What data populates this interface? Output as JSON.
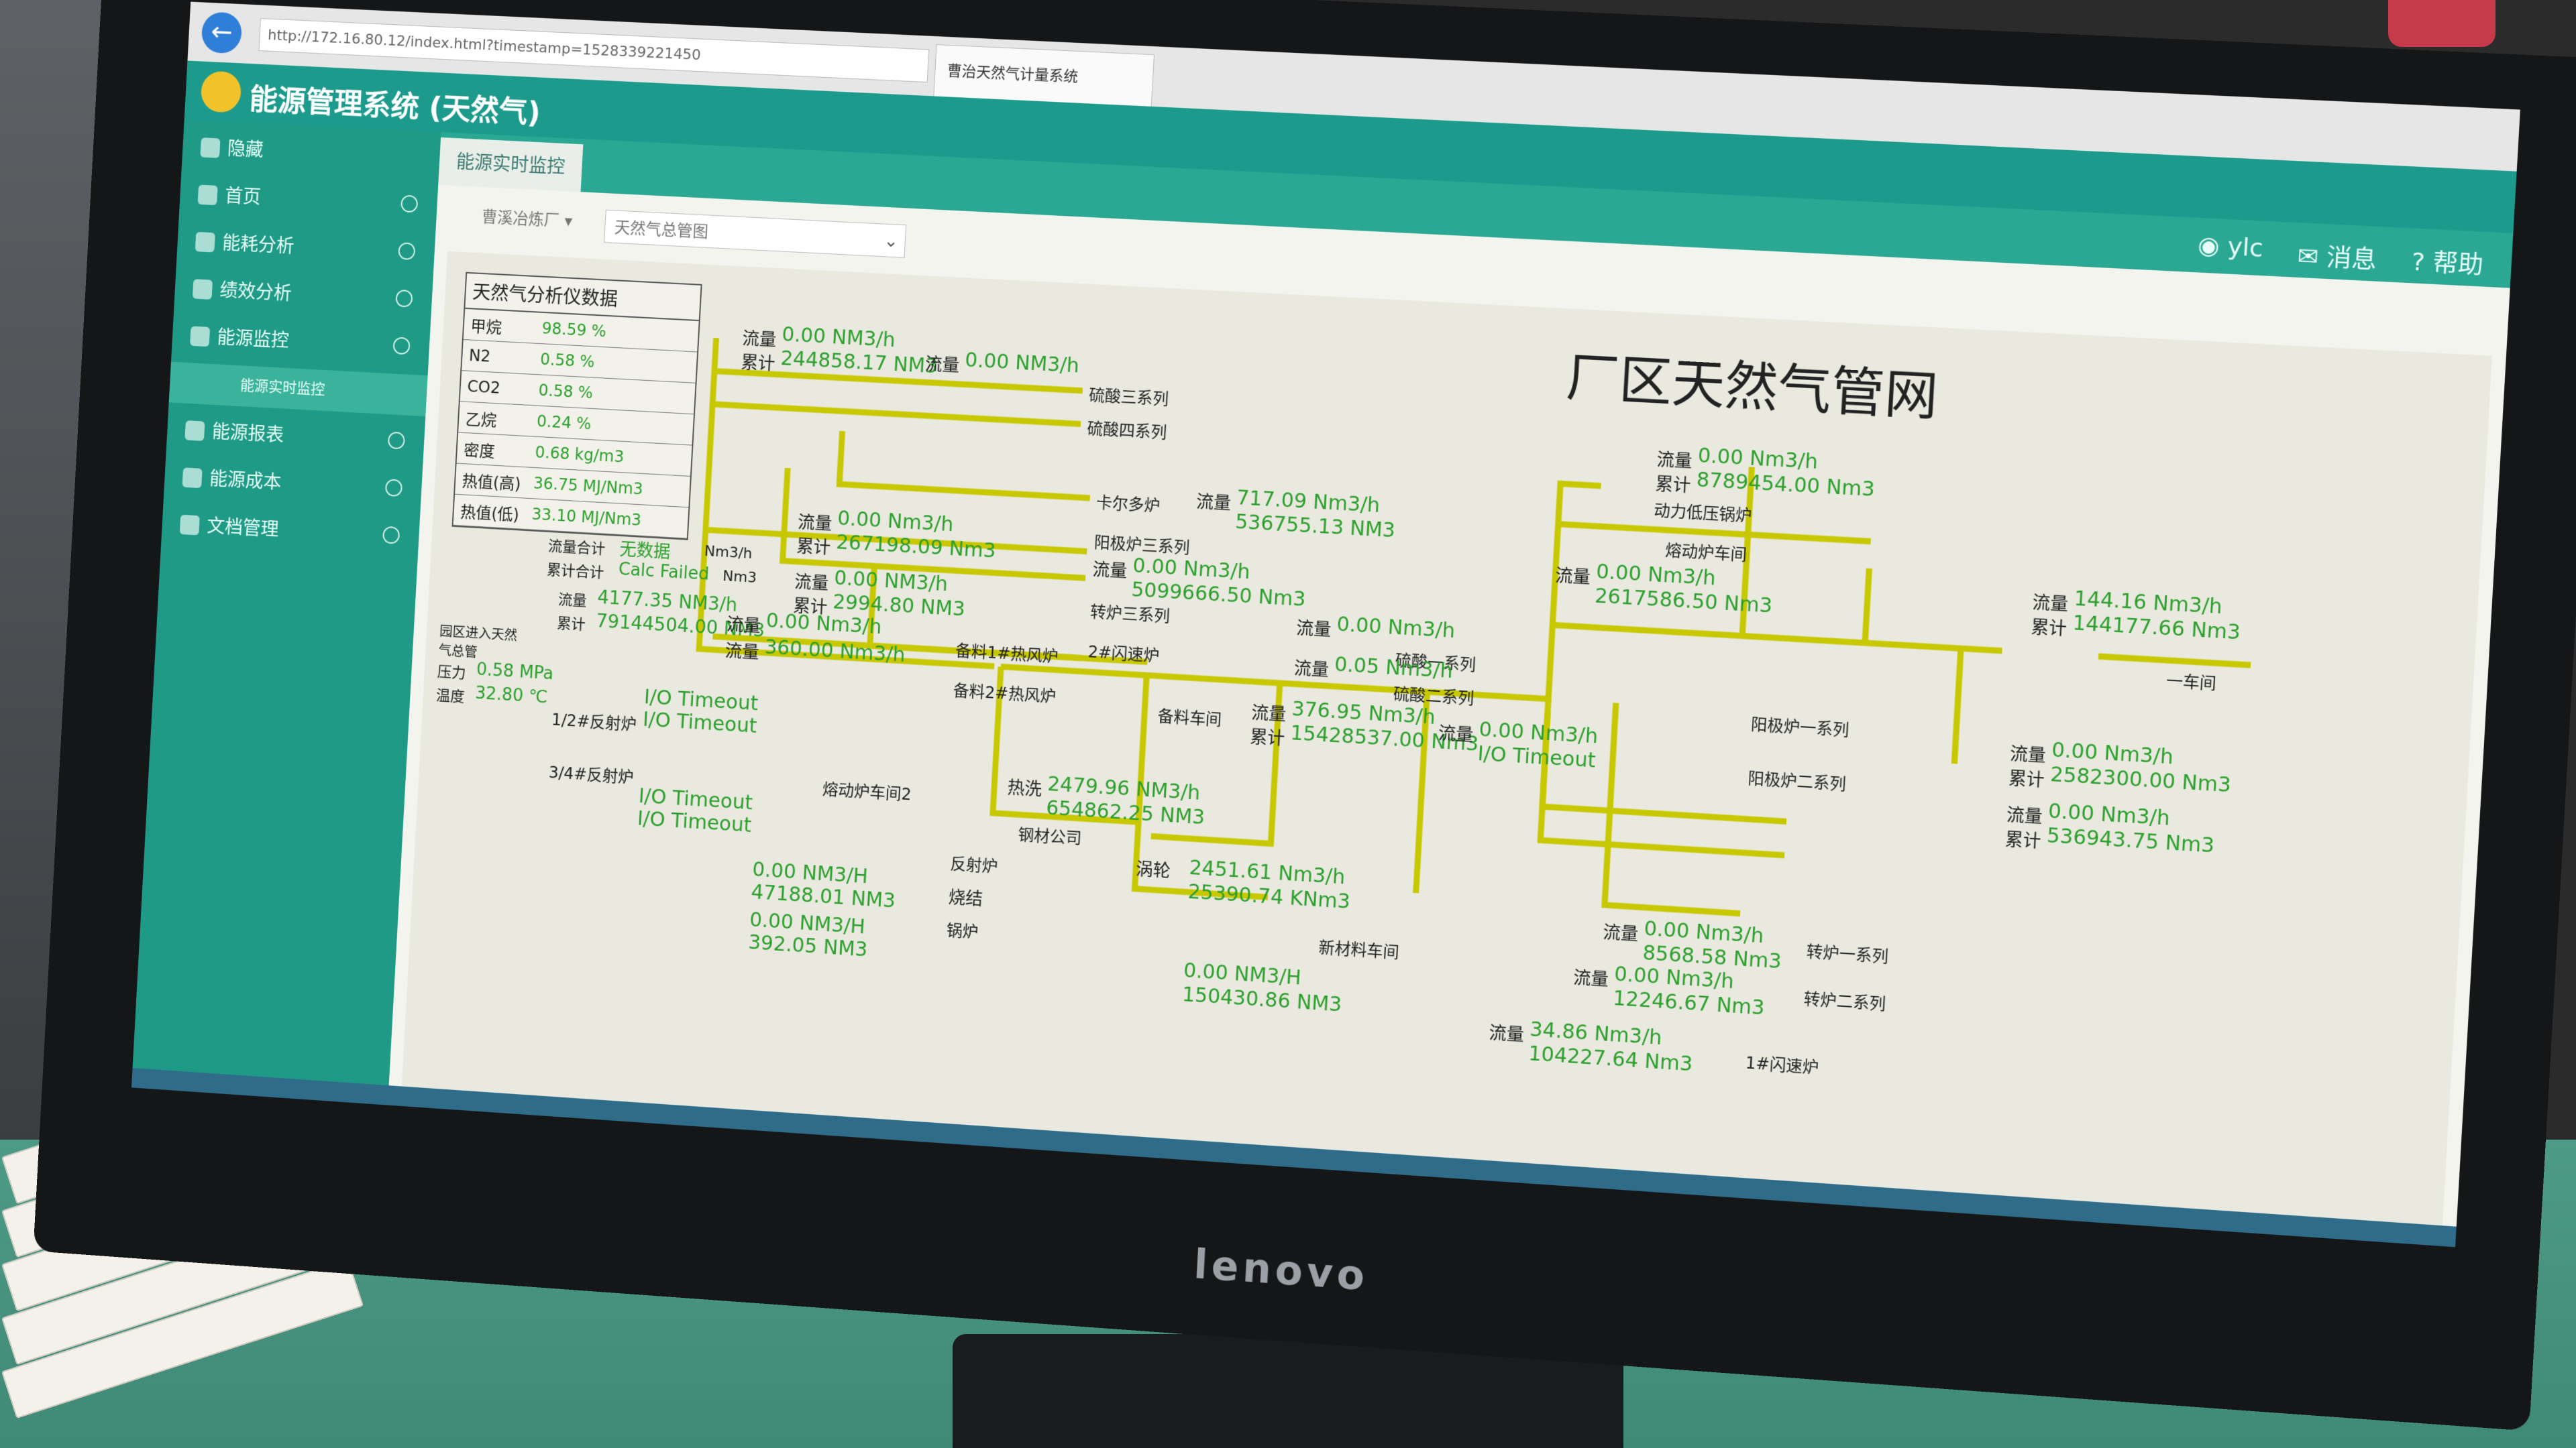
{
  "browser": {
    "url": "http://172.16.80.12/index.html?timestamp=1528339221450",
    "tab_title": "曹治天然气计量系统"
  },
  "app": {
    "title": "能源管理系统 (天然气)",
    "active_tab": "能源实时监控",
    "user": "ylc",
    "messages": "消息",
    "help": "帮助"
  },
  "sidebar": {
    "items": [
      {
        "label": "隐藏"
      },
      {
        "label": "首页"
      },
      {
        "label": "能耗分析"
      },
      {
        "label": "绩效分析"
      },
      {
        "label": "能源监控"
      },
      {
        "label": "能源实时监控"
      },
      {
        "label": "能源报表"
      },
      {
        "label": "能源成本"
      },
      {
        "label": "文档管理"
      }
    ]
  },
  "filters": {
    "plant": "曹溪冶炼厂",
    "pipeline": "天然气总管图"
  },
  "diagram": {
    "title": "厂区天然气管网",
    "analyzer": {
      "title": "天然气分析仪数据",
      "rows": [
        {
          "name": "甲烷",
          "value": "98.59 %"
        },
        {
          "name": "N2",
          "value": "0.58 %"
        },
        {
          "name": "CO2",
          "value": "0.58 %"
        },
        {
          "name": "乙烷",
          "value": "0.24 %"
        },
        {
          "name": "密度",
          "value": "0.68 kg/m3"
        },
        {
          "name": "热值(高)",
          "value": "36.75 MJ/Nm3"
        },
        {
          "name": "热值(低)",
          "value": "33.10 MJ/Nm3"
        }
      ]
    },
    "labels": {
      "flow": "流量",
      "total": "累计",
      "flow_total": "流量合计",
      "total_total": "累计合计",
      "pressure": "压力",
      "temperature": "温度",
      "inlet": "园区进入天然气总管"
    },
    "inlet": {
      "flow_sum": "无数据",
      "flow_sum_unit": "Nm3/h",
      "total_sum": "Calc Failed",
      "total_sum_unit": "Nm3",
      "flow": "4177.35 NM3/h",
      "total": "79144504.00 NM3",
      "pressure": "0.58 MPa",
      "temperature": "32.80 ℃"
    },
    "branches": [
      {
        "name": "硫酸三系列",
        "flow": "0.00 NM3/h",
        "total": "244858.17 NM3"
      },
      {
        "name": "硫酸四系列",
        "flow": "0.00 NM3/h",
        "total": ""
      },
      {
        "name": "卡尔多炉",
        "flow": "717.09 Nm3/h",
        "total": "536755.13 NM3"
      },
      {
        "name": "阳极炉三系列",
        "flow": "0.00 Nm3/h",
        "total": "267198.09 Nm3"
      },
      {
        "name": "转炉三系列",
        "flow": "0.00 Nm3/h",
        "total": "5099666.50 Nm3"
      },
      {
        "name": "动力低压锅炉",
        "flow": "0.00 Nm3/h",
        "total": "8789454.00 Nm3"
      },
      {
        "name": "熔动炉车间",
        "flow": "0.00 Nm3/h",
        "total": "2617586.50 Nm3"
      },
      {
        "name": "一车间",
        "flow": "144.16 Nm3/h",
        "total": "144177.66 Nm3"
      },
      {
        "name": "2#闪速炉",
        "flow": "0.00 NM3/h",
        "total": "2994.80 NM3"
      },
      {
        "name": "备料1#热风炉",
        "flow": "0.00 Nm3/h",
        "total": ""
      },
      {
        "name": "备料2#热风炉",
        "flow": "360.00 Nm3/h",
        "total": ""
      },
      {
        "name": "硫酸一系列",
        "flow": "0.00 Nm3/h",
        "total": ""
      },
      {
        "name": "硫酸二系列",
        "flow": "0.05 Nm3/h",
        "total": ""
      },
      {
        "name": "备料车间",
        "flow": "376.95 Nm3/h",
        "total": "15428537.00 Nm3"
      },
      {
        "name": "阳极炉一系列",
        "flow": "0.00 Nm3/h",
        "total": "I/O Timeout"
      },
      {
        "name": "阳极炉二系列",
        "flow": "0.00 Nm3/h",
        "total": "2582300.00 Nm3"
      },
      {
        "name": "阳极炉二系列累积",
        "flow": "0.00 Nm3/h",
        "total": "536943.75 Nm3"
      },
      {
        "name": "1/2#反射炉",
        "flow": "I/O Timeout",
        "total": "I/O Timeout"
      },
      {
        "name": "3/4#反射炉",
        "flow": "I/O Timeout",
        "total": "I/O Timeout"
      },
      {
        "name": "熔动炉车间2",
        "flow": "2479.96 NM3/h",
        "total": "654862.25 NM3"
      },
      {
        "name": "钢材公司",
        "flow": "2451.61 Nm3/h",
        "total": "25390.74 KNm3"
      },
      {
        "name": "反射炉",
        "flow": "0.00 NM3/H",
        "total": "47188.01 NM3"
      },
      {
        "name": "锅炉",
        "flow": "0.00 NM3/H",
        "total": "392.05 NM3"
      },
      {
        "name": "新材料车间",
        "flow": "0.00 NM3/H",
        "total": "150430.86 NM3"
      },
      {
        "name": "转炉一系列",
        "flow": "0.00 Nm3/h",
        "total": "8568.58 Nm3"
      },
      {
        "name": "转炉二系列",
        "flow": "0.00 Nm3/h",
        "total": "12246.67 Nm3"
      },
      {
        "name": "1#闪速炉",
        "flow": "34.86 Nm3/h",
        "total": "104227.64 Nm3"
      }
    ],
    "extra_labels": {
      "heat": "热洗",
      "sinter": "烧结",
      "vortex": "涡轮"
    }
  },
  "monitor": {
    "brand": "lenovo"
  },
  "colors": {
    "pipe": "#c8c800",
    "value": "#2c9f2c",
    "header": "#1c9a8c",
    "sidebar": "#1f9a86"
  }
}
